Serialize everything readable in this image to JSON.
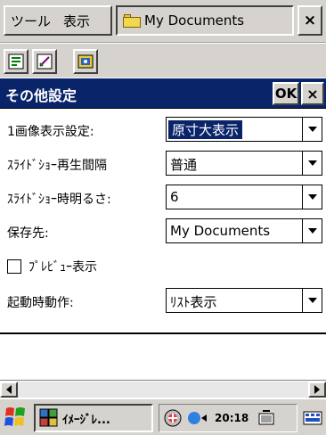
{
  "menubar": {
    "tool_label": "ツール",
    "view_label": "表示",
    "folder_label": "My Documents",
    "close_label": "×"
  },
  "dialog": {
    "title": "その他設定",
    "ok_label": "OK",
    "close_label": "×",
    "fields": [
      {
        "label": "1画像表示設定:",
        "value": "原寸大表示"
      },
      {
        "label": "ｽﾗｲﾄﾞｼｮｰ再生間隔",
        "value": "普通"
      },
      {
        "label": "ｽﾗｲﾄﾞｼｮｰ時明るさ:",
        "value": "6"
      },
      {
        "label": "保存先:",
        "value": "My Documents"
      }
    ],
    "preview_checkbox_label": "ﾌﾟﾚﾋﾞｭｰ表示",
    "preview_checked": false,
    "startup": {
      "label": "起動時動作:",
      "value": "ﾘｽﾄ表示"
    }
  },
  "taskbar": {
    "task_label": "ｲﾒｰｼﾞﾚ...",
    "time": "20:18"
  },
  "colors": {
    "title_bar": "#0a246a",
    "chrome": "#d6d3ce",
    "selection": "#0a246a"
  }
}
